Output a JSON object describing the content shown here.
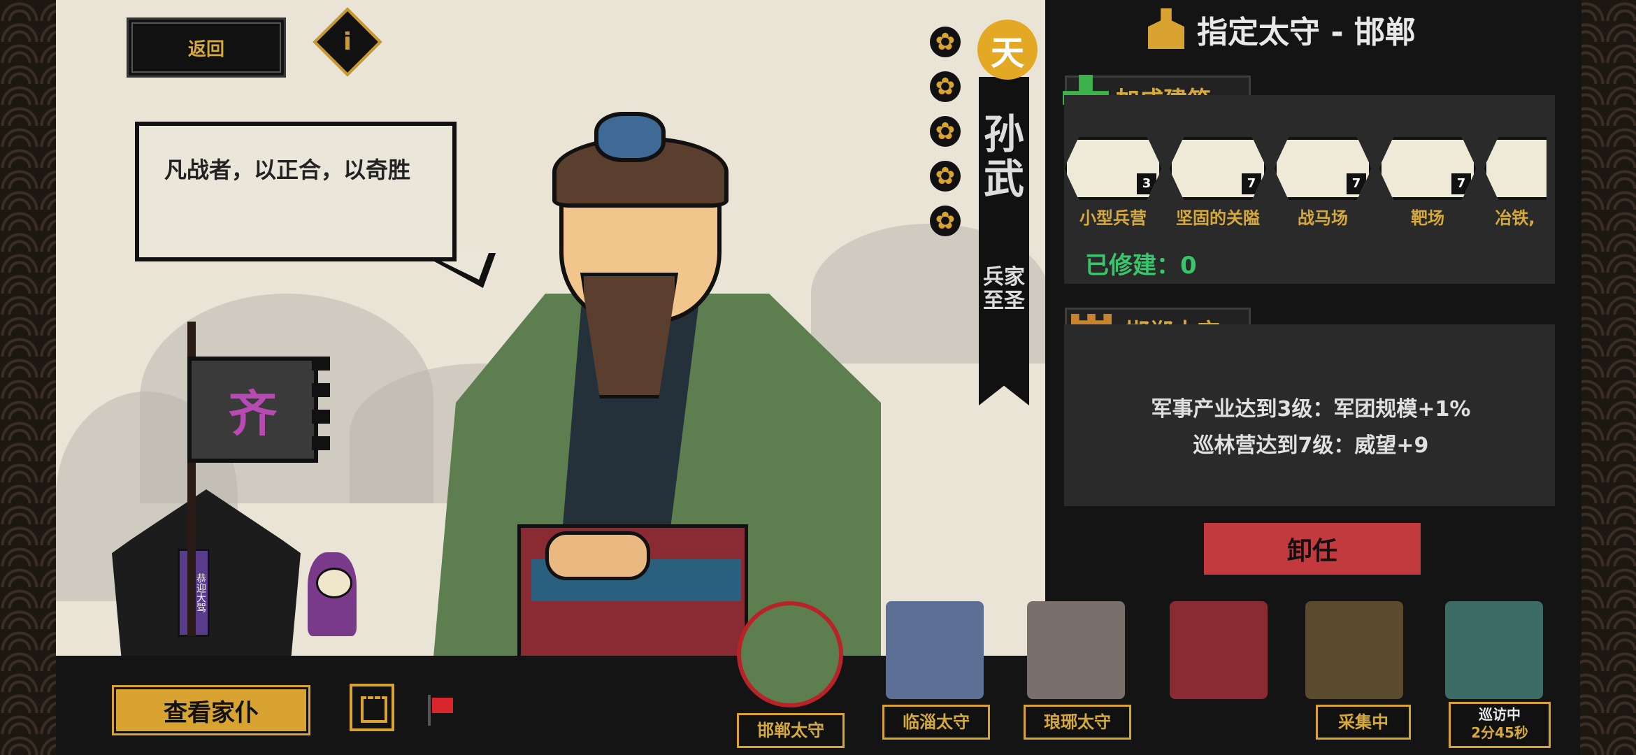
{
  "top": {
    "back_label": "返回",
    "info_label": "i"
  },
  "dialogue": "凡战者，以正合，以奇胜",
  "scene": {
    "flag_text": "齐",
    "gate_banner": "恭迎大驾"
  },
  "hero": {
    "tier": "天",
    "name": "孙武",
    "title": "兵家至圣",
    "stars": 5
  },
  "panel": {
    "header": "指定太守 - 邯郸",
    "bonus_section": "加成建筑",
    "buildings": [
      {
        "name": "小型兵营",
        "level": "3"
      },
      {
        "name": "坚固的关隘",
        "level": "7"
      },
      {
        "name": "战马场",
        "level": "7"
      },
      {
        "name": "靶场",
        "level": "7"
      },
      {
        "name": "冶铁,",
        "level": ""
      }
    ],
    "built_label": "已修建：0",
    "governor_section": "邯郸太守",
    "bonuses": [
      "军事产业达到3级：军团规模+1%",
      "巡林营达到7级：威望+9"
    ],
    "dismiss_label": "卸任"
  },
  "bottom": {
    "servants_label": "查看家仆",
    "governors": [
      {
        "label": "邯郸太守"
      },
      {
        "label": "临淄太守"
      },
      {
        "label": "琅琊太守"
      },
      {
        "label": ""
      },
      {
        "label": "采集中"
      },
      {
        "label": "巡访中",
        "timer": "2分45秒"
      }
    ]
  },
  "colors": {
    "accent": "#d8a331",
    "dismiss": "#c23a3e",
    "built": "#37c76a"
  }
}
